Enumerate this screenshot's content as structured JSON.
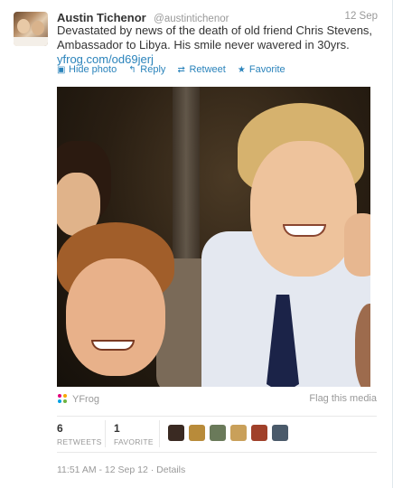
{
  "tweet": {
    "author_name": "Austin Tichenor",
    "author_handle": "@austintichenor",
    "date_short": "12 Sep",
    "text": "Devastated by news of the death of old friend Chris Stevens, Ambassador to Libya. His smile never wavered in 30yrs.",
    "link": "yfrog.com/od69jerj"
  },
  "actions": [
    {
      "icon": "photo-icon",
      "label": "Hide photo"
    },
    {
      "icon": "reply-icon",
      "label": "Reply"
    },
    {
      "icon": "retweet-icon",
      "label": "Retweet"
    },
    {
      "icon": "star-icon",
      "label": "Favorite"
    }
  ],
  "media": {
    "provider": "YFrog",
    "flag_label": "Flag this media"
  },
  "stats": {
    "retweets_count": "6",
    "retweets_label": "RETWEETS",
    "favorites_count": "1",
    "favorites_label": "FAVORITE"
  },
  "favoriters": [
    {
      "color": "#3a2a22"
    },
    {
      "color": "#b88b3a"
    },
    {
      "color": "#6a7a5a"
    },
    {
      "color": "#c9a05a"
    },
    {
      "color": "#a0402a"
    },
    {
      "color": "#4a5a6a"
    }
  ],
  "meta": {
    "full_timestamp": "11:51 AM - 12 Sep 12",
    "separator": " · ",
    "details": "Details"
  }
}
